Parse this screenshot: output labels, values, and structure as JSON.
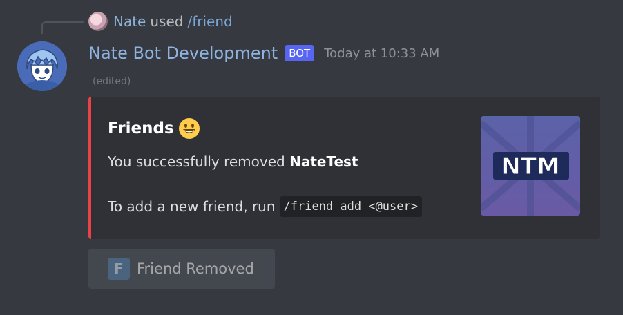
{
  "reply": {
    "user": "Nate",
    "used_text": "used",
    "command": "/friend"
  },
  "message": {
    "username": "Nate Bot Development",
    "bot_tag": "BOT",
    "timestamp": "Today at 10:33 AM",
    "edited": "(edited)"
  },
  "embed": {
    "accent_color": "#ed4245",
    "title": "Friends",
    "title_emoji": "grinning-face",
    "line1_prefix": "You successfully removed ",
    "line1_user": "NateTest",
    "line2_prefix": "To add a new friend, run",
    "line2_code": "/friend add <@user>",
    "thumbnail_text": "NTM"
  },
  "button": {
    "icon_letter": "F",
    "label": "Friend Removed",
    "disabled": true
  }
}
